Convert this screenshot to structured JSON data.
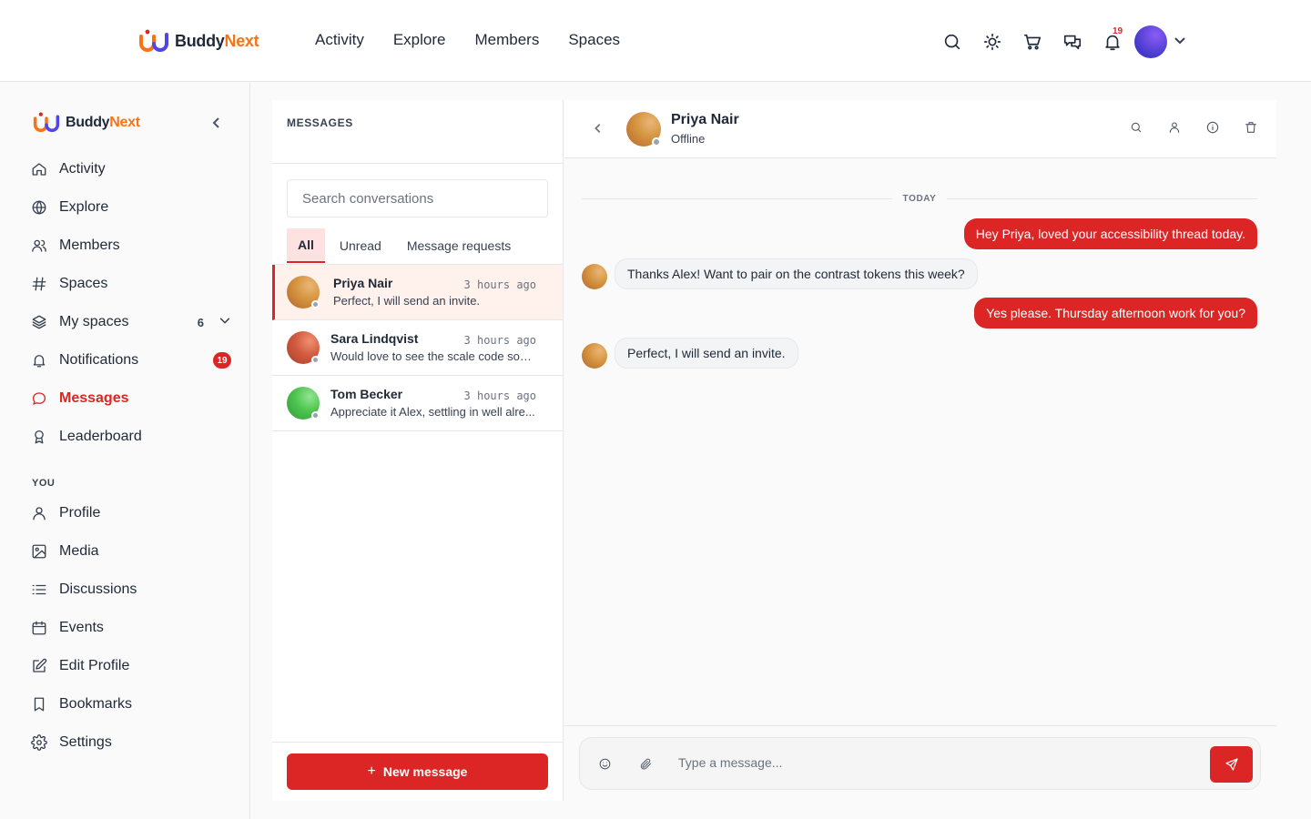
{
  "colors": {
    "accent": "#dc2626",
    "brand_orange": "#f97316",
    "brand_dark": "#1f2937"
  },
  "brand": {
    "name_part1": "Buddy",
    "name_part2": "Next"
  },
  "topnav": {
    "items": [
      "Activity",
      "Explore",
      "Members",
      "Spaces"
    ]
  },
  "topbar": {
    "notification_count": "19",
    "icons": [
      "search-icon",
      "sun-icon",
      "cart-icon",
      "chat-icon",
      "bell-icon"
    ]
  },
  "sidebar": {
    "main_items": [
      {
        "label": "Activity",
        "icon": "home-icon"
      },
      {
        "label": "Explore",
        "icon": "globe-icon"
      },
      {
        "label": "Members",
        "icon": "users-icon"
      },
      {
        "label": "Spaces",
        "icon": "hash-icon"
      },
      {
        "label": "My spaces",
        "icon": "layers-icon",
        "count": "6"
      },
      {
        "label": "Notifications",
        "icon": "bell-icon",
        "badge": "19"
      },
      {
        "label": "Messages",
        "icon": "message-icon",
        "active": true
      },
      {
        "label": "Leaderboard",
        "icon": "award-icon"
      }
    ],
    "section_label": "YOU",
    "you_items": [
      {
        "label": "Profile",
        "icon": "user-icon"
      },
      {
        "label": "Media",
        "icon": "image-icon"
      },
      {
        "label": "Discussions",
        "icon": "list-icon"
      },
      {
        "label": "Events",
        "icon": "calendar-icon"
      },
      {
        "label": "Edit Profile",
        "icon": "edit-icon"
      },
      {
        "label": "Bookmarks",
        "icon": "bookmark-icon"
      },
      {
        "label": "Settings",
        "icon": "gear-icon"
      }
    ]
  },
  "messages_panel": {
    "title": "MESSAGES",
    "search_placeholder": "Search conversations",
    "tabs": [
      "All",
      "Unread",
      "Message requests"
    ],
    "active_tab": "All",
    "conversations": [
      {
        "name": "Priya Nair",
        "time": "3 hours ago",
        "snippet": "Perfect, I will send an invite.",
        "active": true,
        "avatar_color": "#d4943f"
      },
      {
        "name": "Sara Lindqvist",
        "time": "3 hours ago",
        "snippet": "Would love to see the scale code som...",
        "active": false,
        "avatar_color": "#d25a3f"
      },
      {
        "name": "Tom Becker",
        "time": "3 hours ago",
        "snippet": "Appreciate it Alex, settling in well alre...",
        "active": false,
        "avatar_color": "#4ec54e"
      }
    ],
    "new_message_label": "New message"
  },
  "chat": {
    "contact_name": "Priya Nair",
    "contact_status": "Offline",
    "day_label": "TODAY",
    "messages": [
      {
        "direction": "out",
        "text": "Hey Priya, loved your accessibility thread today."
      },
      {
        "direction": "in",
        "text": "Thanks Alex! Want to pair on the contrast tokens this week?"
      },
      {
        "direction": "out",
        "text": "Yes please. Thursday afternoon work for you?"
      },
      {
        "direction": "in",
        "text": "Perfect, I will send an invite."
      }
    ],
    "composer_placeholder": "Type a message..."
  }
}
